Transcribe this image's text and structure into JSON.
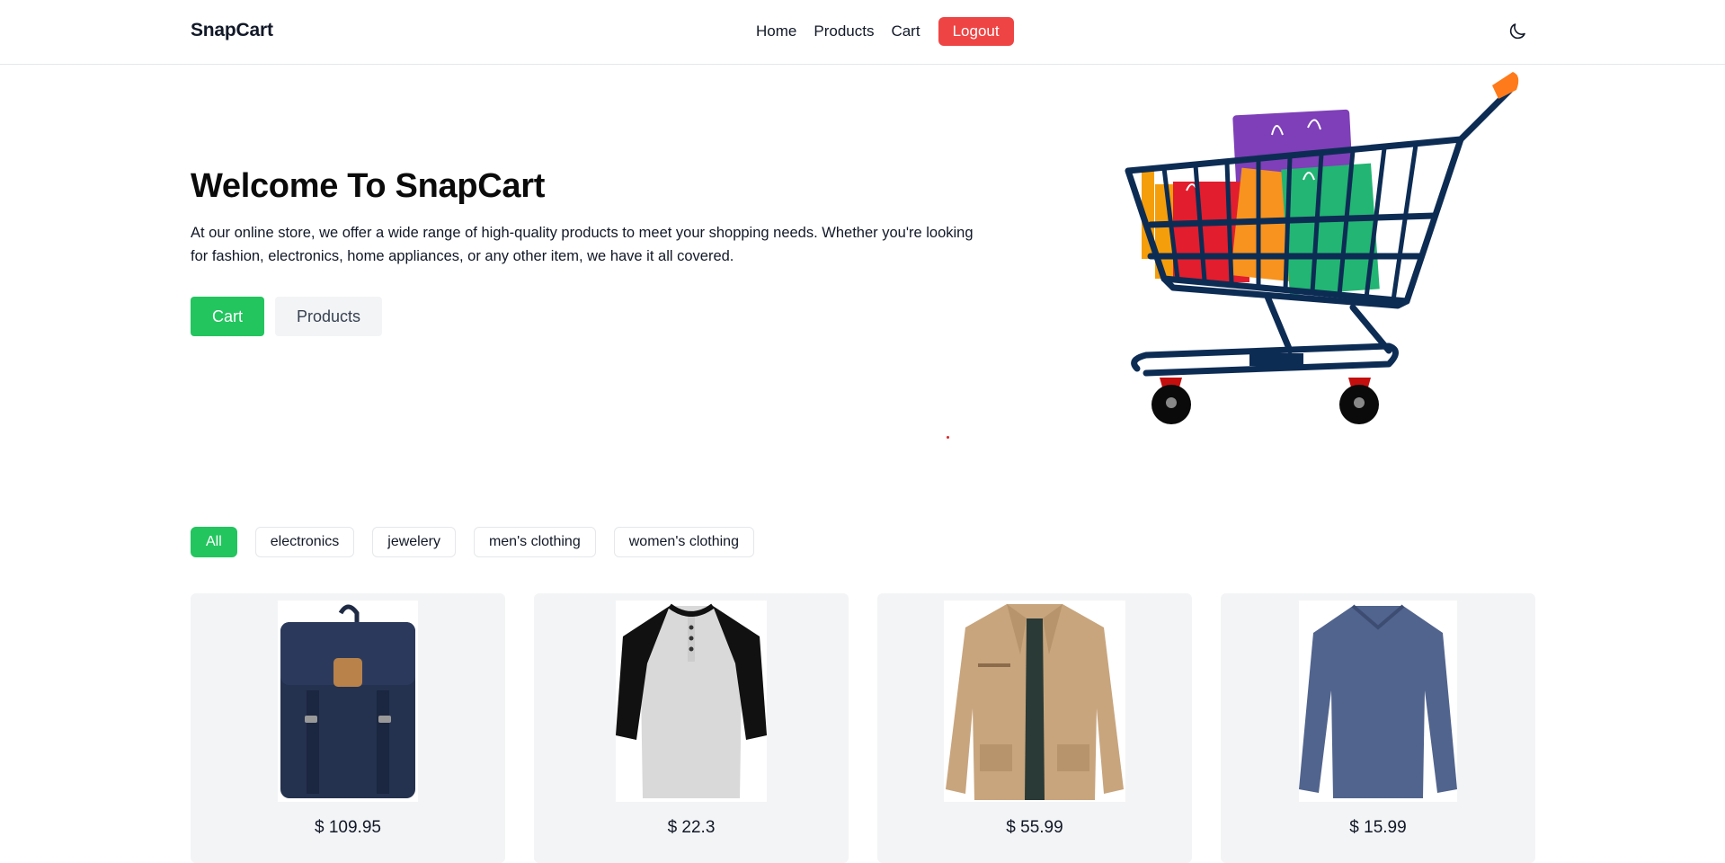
{
  "nav": {
    "brand": "SnapCart",
    "links": [
      "Home",
      "Products",
      "Cart"
    ],
    "logout": "Logout",
    "theme_icon": "moon-icon"
  },
  "hero": {
    "title": "Welcome To SnapCart",
    "description": "At our online store, we offer a wide range of high-quality products to meet your shopping needs. Whether you're looking for fashion, electronics, home appliances, or any other item, we have it all covered.",
    "cart_button": "Cart",
    "products_button": "Products",
    "image": "shopping-cart-illustration"
  },
  "filters": {
    "active": "All",
    "items": [
      "All",
      "electronics",
      "jewelery",
      "men's clothing",
      "women's clothing"
    ]
  },
  "products": [
    {
      "image": "backpack",
      "price": "$ 109.95"
    },
    {
      "image": "raglan-henley-shirt",
      "price": "$ 22.3"
    },
    {
      "image": "khaki-jacket",
      "price": "$ 55.99"
    },
    {
      "image": "long-sleeve-shirt",
      "price": "$ 15.99"
    }
  ],
  "colors": {
    "accent_green": "#22c55e",
    "logout_red": "#ef4444",
    "card_bg": "#f3f4f6"
  }
}
